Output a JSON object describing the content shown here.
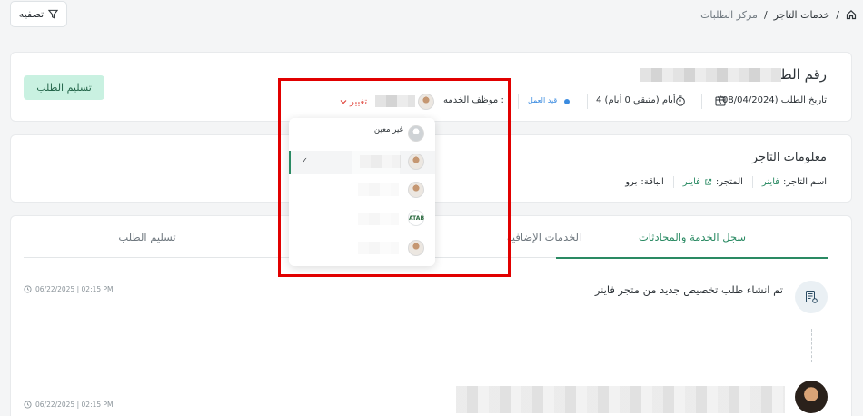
{
  "filter_button": {
    "label": "تصفيه",
    "icon": "filter-icon"
  },
  "breadcrumb": {
    "home_icon": "home-icon",
    "separator": "/",
    "items": [
      "خدمات التاجر",
      "مركز الطلبات"
    ]
  },
  "order": {
    "title": "رقم الطلب",
    "date_label": "تاريخ الطلب (08/04/2024)",
    "duration_label": "4 أيام (متبقي 0 أيام)",
    "status_label": "قيد العمل",
    "employee_label": "موظف الخدمه :",
    "change_label": "تغيير",
    "deliver_button": "تسليم الطلب"
  },
  "assignee_dropdown": {
    "items": [
      {
        "label": "غير معين",
        "avatar": "default-avatar"
      },
      {
        "label": "",
        "avatar": "person-avatar",
        "selected": true
      },
      {
        "label": "",
        "avatar": "person-avatar"
      },
      {
        "label": "",
        "avatar": "company-logo",
        "logo_text": "ATAB"
      },
      {
        "label": "",
        "avatar": "person-avatar"
      }
    ],
    "check_mark": "✓"
  },
  "merchant": {
    "title": "معلومات التاجر",
    "name_label": "اسم التاجر:",
    "name_value": "فاينر",
    "store_label": "المتجر:",
    "store_value": "فاينر",
    "package_label": "الباقة:",
    "package_value": "برو"
  },
  "tabs": [
    "سجل الخدمة والمحادثات",
    "الخدمات الإضافية",
    "تسليم الطلب"
  ],
  "activity": [
    {
      "text": "تم انشاء طلب تخصيص جديد من متجر فاينر",
      "time": "06/22/2025 | 02:15 PM"
    },
    {
      "text": "",
      "time": "06/22/2025 | 02:15 PM"
    }
  ],
  "colors": {
    "accent": "#2a8a63",
    "highlight": "#e10000",
    "status": "#3a8be0",
    "change": "#e0453c"
  }
}
